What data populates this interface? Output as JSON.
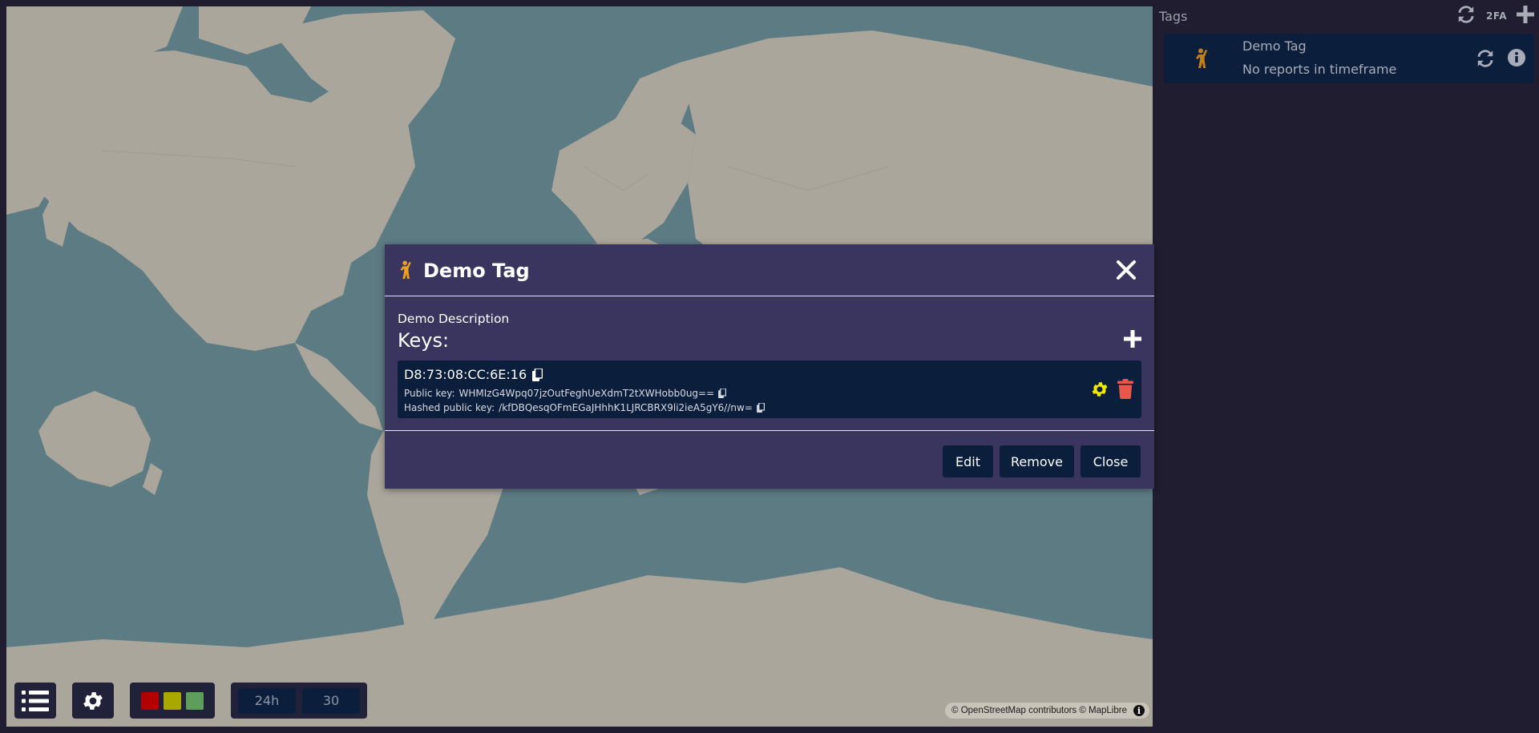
{
  "map": {
    "attribution": "© OpenStreetMap contributors © MapLibre",
    "attribution_info_glyph": "i",
    "colors": {
      "ocean": "#5d7b83",
      "land": "#aaa69c"
    }
  },
  "controls": {
    "list_icon": "list-icon",
    "settings_icon": "gear-icon",
    "status_colors": [
      "#b30000",
      "#a8a800",
      "#5d9e5d"
    ],
    "time_range": "24h",
    "count": "30"
  },
  "sidebar": {
    "title": "Tags",
    "refresh_icon": "refresh-icon",
    "twofa_label": "2FA",
    "add_icon": "plus-icon",
    "tags": [
      {
        "name": "Demo Tag",
        "status": "No reports in timeframe",
        "icon": "person-waving-icon",
        "icon_color": "#c47f1a"
      }
    ]
  },
  "modal": {
    "title": "Demo Tag",
    "description": "Demo Description",
    "keys_label": "Keys:",
    "keys": [
      {
        "id": "D8:73:08:CC:6E:16",
        "public_key_label": "Public key:",
        "public_key": "WHMIzG4Wpq07jzOutFeghUeXdmT2tXWHobb0ug==",
        "hashed_label": "Hashed public key:",
        "hashed_key": "/kfDBQesqOFmEGaJHhhK1LJRCBRX9li2ieA5gY6//nw="
      }
    ],
    "buttons": {
      "edit": "Edit",
      "remove": "Remove",
      "close": "Close"
    },
    "colors": {
      "background": "#3a355f",
      "settings": "#f0e800",
      "delete": "#e8574a",
      "title_icon": "#f0a020"
    }
  }
}
